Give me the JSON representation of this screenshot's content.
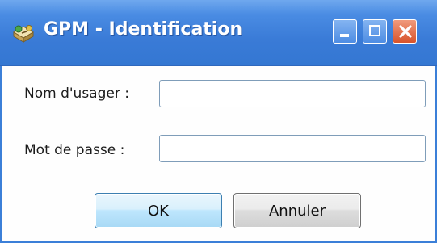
{
  "window": {
    "title": "GPM - Identification",
    "icon": "gpm-app-icon",
    "controls": {
      "minimize_icon": "minimize-icon",
      "maximize_icon": "maximize-icon",
      "close_icon": "close-icon"
    },
    "colors": {
      "titlebar": "#3a7bd7",
      "close_button": "#d8532b",
      "ok_button": "#bee6fd"
    }
  },
  "form": {
    "username_label": "Nom d'usager :",
    "username_value": "",
    "password_label": "Mot de passe :",
    "password_value": ""
  },
  "buttons": {
    "ok_label": "OK",
    "cancel_label": "Annuler"
  }
}
